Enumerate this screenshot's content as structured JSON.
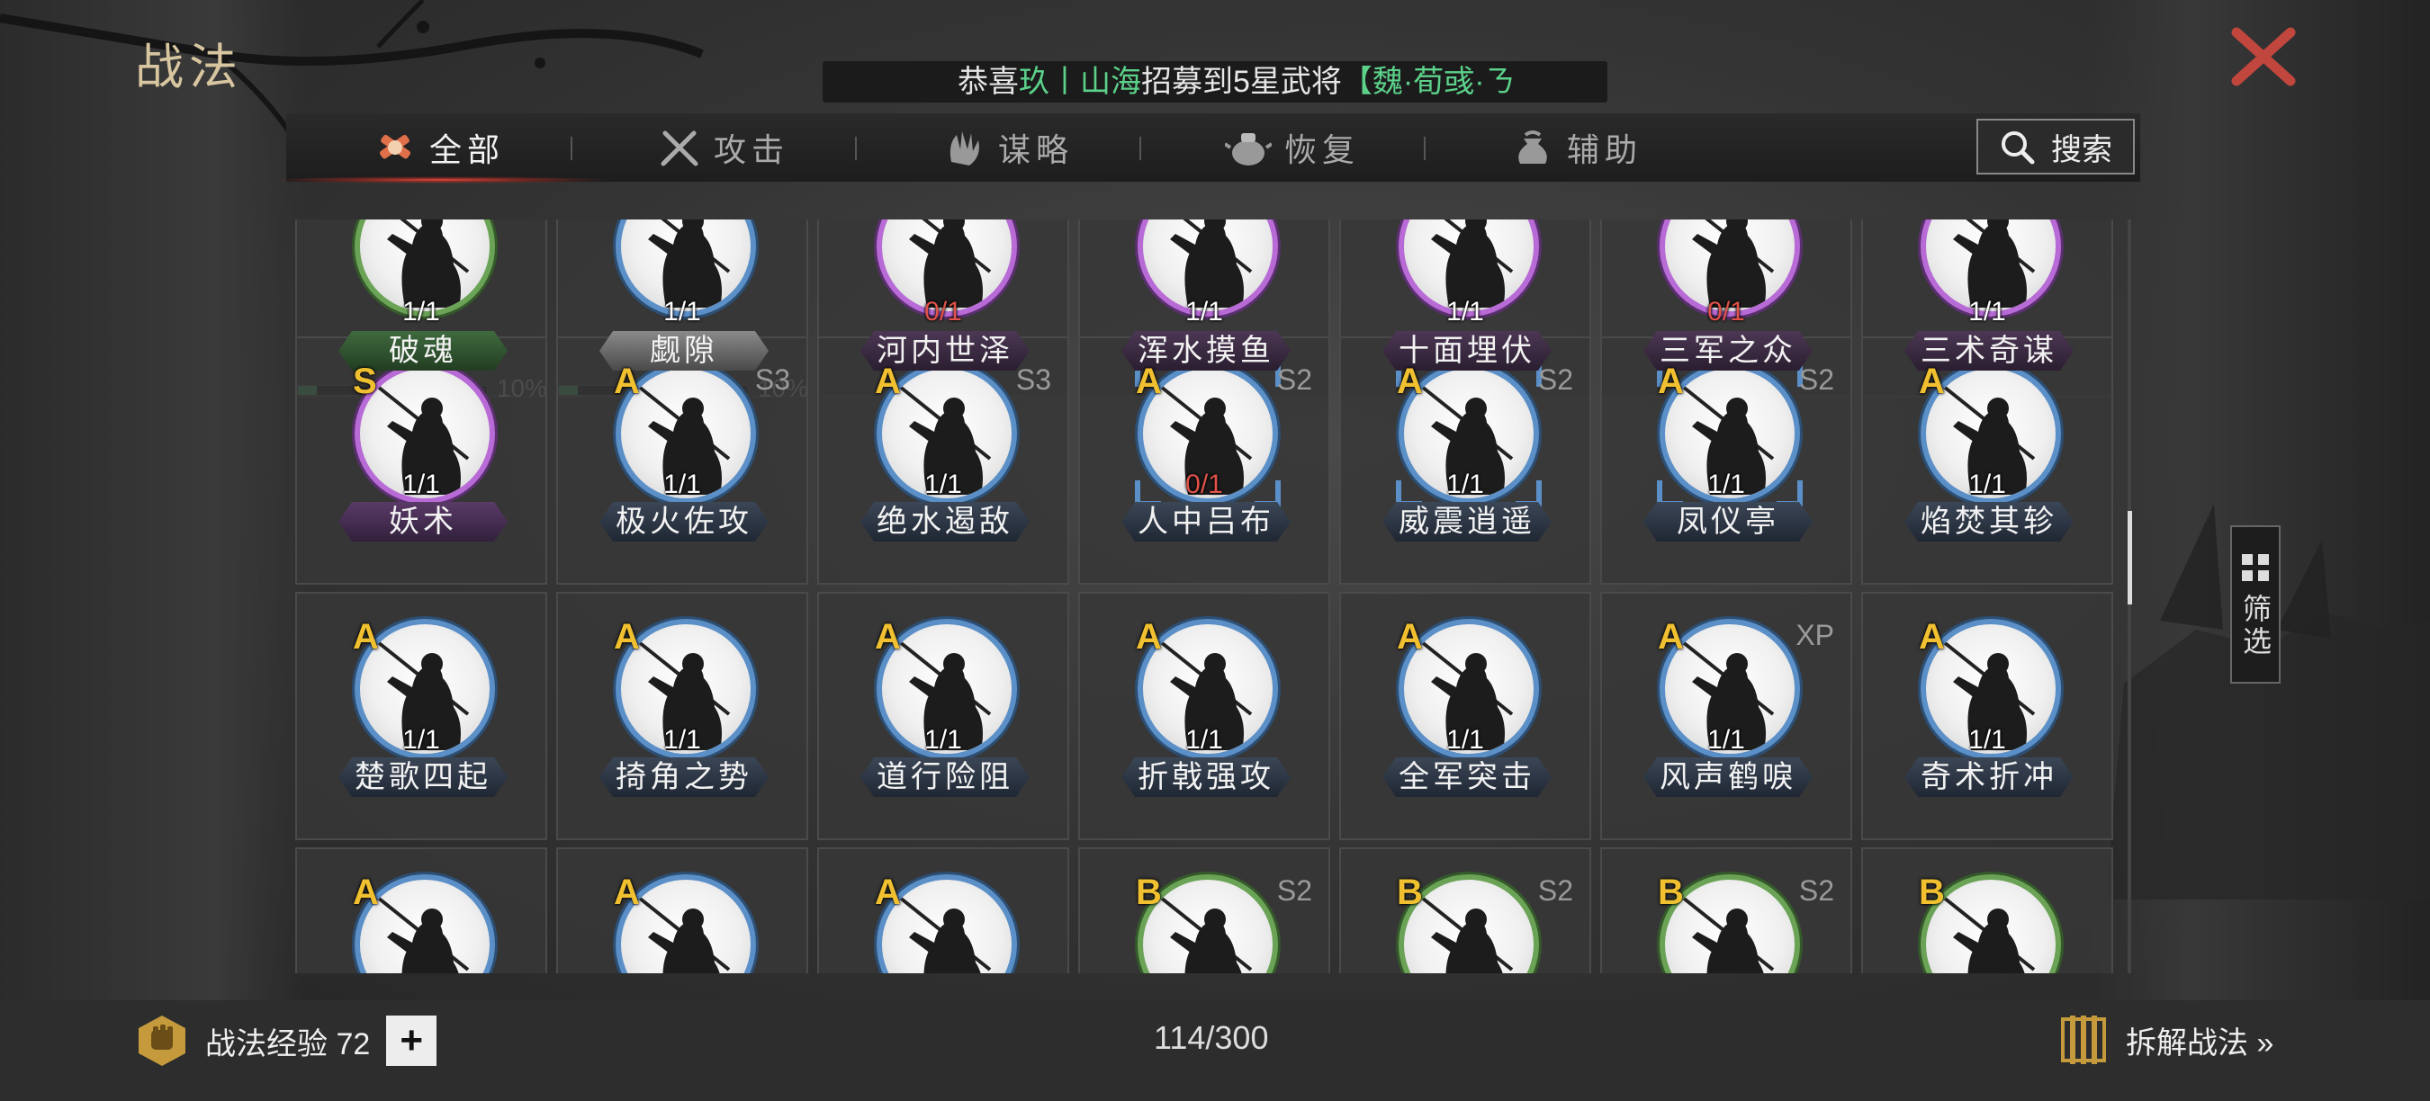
{
  "page_title": "战法",
  "ticker": {
    "prefix": "恭喜",
    "player": "玖丨山海",
    "middle": "招募到5星武将",
    "hero": "【魏·荀彧·",
    "tail": "ㄋ"
  },
  "tabs": [
    {
      "label": "全部",
      "icon": "all-skills-icon",
      "active": true
    },
    {
      "label": "攻击",
      "icon": "crossed-swords-icon",
      "active": false
    },
    {
      "label": "谋略",
      "icon": "hand-scheme-icon",
      "active": false
    },
    {
      "label": "恢复",
      "icon": "medicine-pot-icon",
      "active": false
    },
    {
      "label": "辅助",
      "icon": "pouch-icon",
      "active": false
    }
  ],
  "search": {
    "label": "搜索"
  },
  "filter": {
    "label": "筛选"
  },
  "skills": [
    {
      "name": "破魂",
      "count": "1/1",
      "grade": "",
      "season": "",
      "ring": "B",
      "name_style": "green",
      "progress": 10,
      "progress_label": "10%"
    },
    {
      "name": "觑隙",
      "count": "1/1",
      "grade": "",
      "season": "",
      "ring": "gray",
      "name_style": "gray",
      "progress": 10,
      "progress_label": "10%"
    },
    {
      "name": "河内世泽",
      "count": "0/1",
      "grade": "",
      "season": "",
      "ring": "S",
      "name_style": "purple"
    },
    {
      "name": "浑水摸鱼",
      "count": "1/1",
      "grade": "",
      "season": "",
      "ring": "S",
      "name_style": "purple"
    },
    {
      "name": "十面埋伏",
      "count": "1/1",
      "grade": "",
      "season": "",
      "ring": "S",
      "name_style": "purple"
    },
    {
      "name": "三军之众",
      "count": "0/1",
      "grade": "",
      "season": "",
      "ring": "S",
      "name_style": "purple"
    },
    {
      "name": "三术奇谋",
      "count": "1/1",
      "grade": "",
      "season": "",
      "ring": "S",
      "name_style": "purple"
    },
    {
      "name": "妖术",
      "count": "1/1",
      "grade": "S",
      "season": "",
      "ring": "S",
      "name_style": "S"
    },
    {
      "name": "极火佐攻",
      "count": "1/1",
      "grade": "A",
      "season": "S3",
      "ring": "A",
      "name_style": "A"
    },
    {
      "name": "绝水遏敌",
      "count": "1/1",
      "grade": "A",
      "season": "S3",
      "ring": "A",
      "name_style": "A"
    },
    {
      "name": "人中吕布",
      "count": "0/1",
      "grade": "A",
      "season": "S2",
      "ring": "A",
      "name_style": "A",
      "bracket": true
    },
    {
      "name": "威震逍遥",
      "count": "1/1",
      "grade": "A",
      "season": "S2",
      "ring": "A",
      "name_style": "A",
      "bracket": true
    },
    {
      "name": "凤仪亭",
      "count": "1/1",
      "grade": "A",
      "season": "S2",
      "ring": "A",
      "name_style": "A",
      "bracket": true
    },
    {
      "name": "焰焚其轸",
      "count": "1/1",
      "grade": "A",
      "season": "",
      "ring": "A",
      "name_style": "A"
    },
    {
      "name": "楚歌四起",
      "count": "1/1",
      "grade": "A",
      "season": "",
      "ring": "A",
      "name_style": "A"
    },
    {
      "name": "掎角之势",
      "count": "1/1",
      "grade": "A",
      "season": "",
      "ring": "A",
      "name_style": "A"
    },
    {
      "name": "道行险阻",
      "count": "1/1",
      "grade": "A",
      "season": "",
      "ring": "A",
      "name_style": "A"
    },
    {
      "name": "折戟强攻",
      "count": "1/1",
      "grade": "A",
      "season": "",
      "ring": "A",
      "name_style": "A"
    },
    {
      "name": "全军突击",
      "count": "1/1",
      "grade": "A",
      "season": "",
      "ring": "A",
      "name_style": "A"
    },
    {
      "name": "风声鹤唳",
      "count": "1/1",
      "grade": "A",
      "season": "XP",
      "ring": "A",
      "name_style": "A"
    },
    {
      "name": "奇术折冲",
      "count": "1/1",
      "grade": "A",
      "season": "",
      "ring": "A",
      "name_style": "A"
    },
    {
      "name": "",
      "count": "",
      "grade": "A",
      "season": "",
      "ring": "A",
      "name_style": "A"
    },
    {
      "name": "",
      "count": "",
      "grade": "A",
      "season": "",
      "ring": "A",
      "name_style": "A"
    },
    {
      "name": "",
      "count": "",
      "grade": "A",
      "season": "",
      "ring": "A",
      "name_style": "A"
    },
    {
      "name": "",
      "count": "",
      "grade": "B",
      "season": "S2",
      "ring": "B",
      "name_style": "A"
    },
    {
      "name": "",
      "count": "",
      "grade": "B",
      "season": "S2",
      "ring": "B",
      "name_style": "A"
    },
    {
      "name": "",
      "count": "",
      "grade": "B",
      "season": "S2",
      "ring": "B",
      "name_style": "A"
    },
    {
      "name": "",
      "count": "",
      "grade": "B",
      "season": "",
      "ring": "B",
      "name_style": "A"
    }
  ],
  "footer": {
    "exp_label": "战法经验 72",
    "plus_label": "+",
    "capacity": "114/300",
    "dismantle_label": "拆解战法 »"
  }
}
